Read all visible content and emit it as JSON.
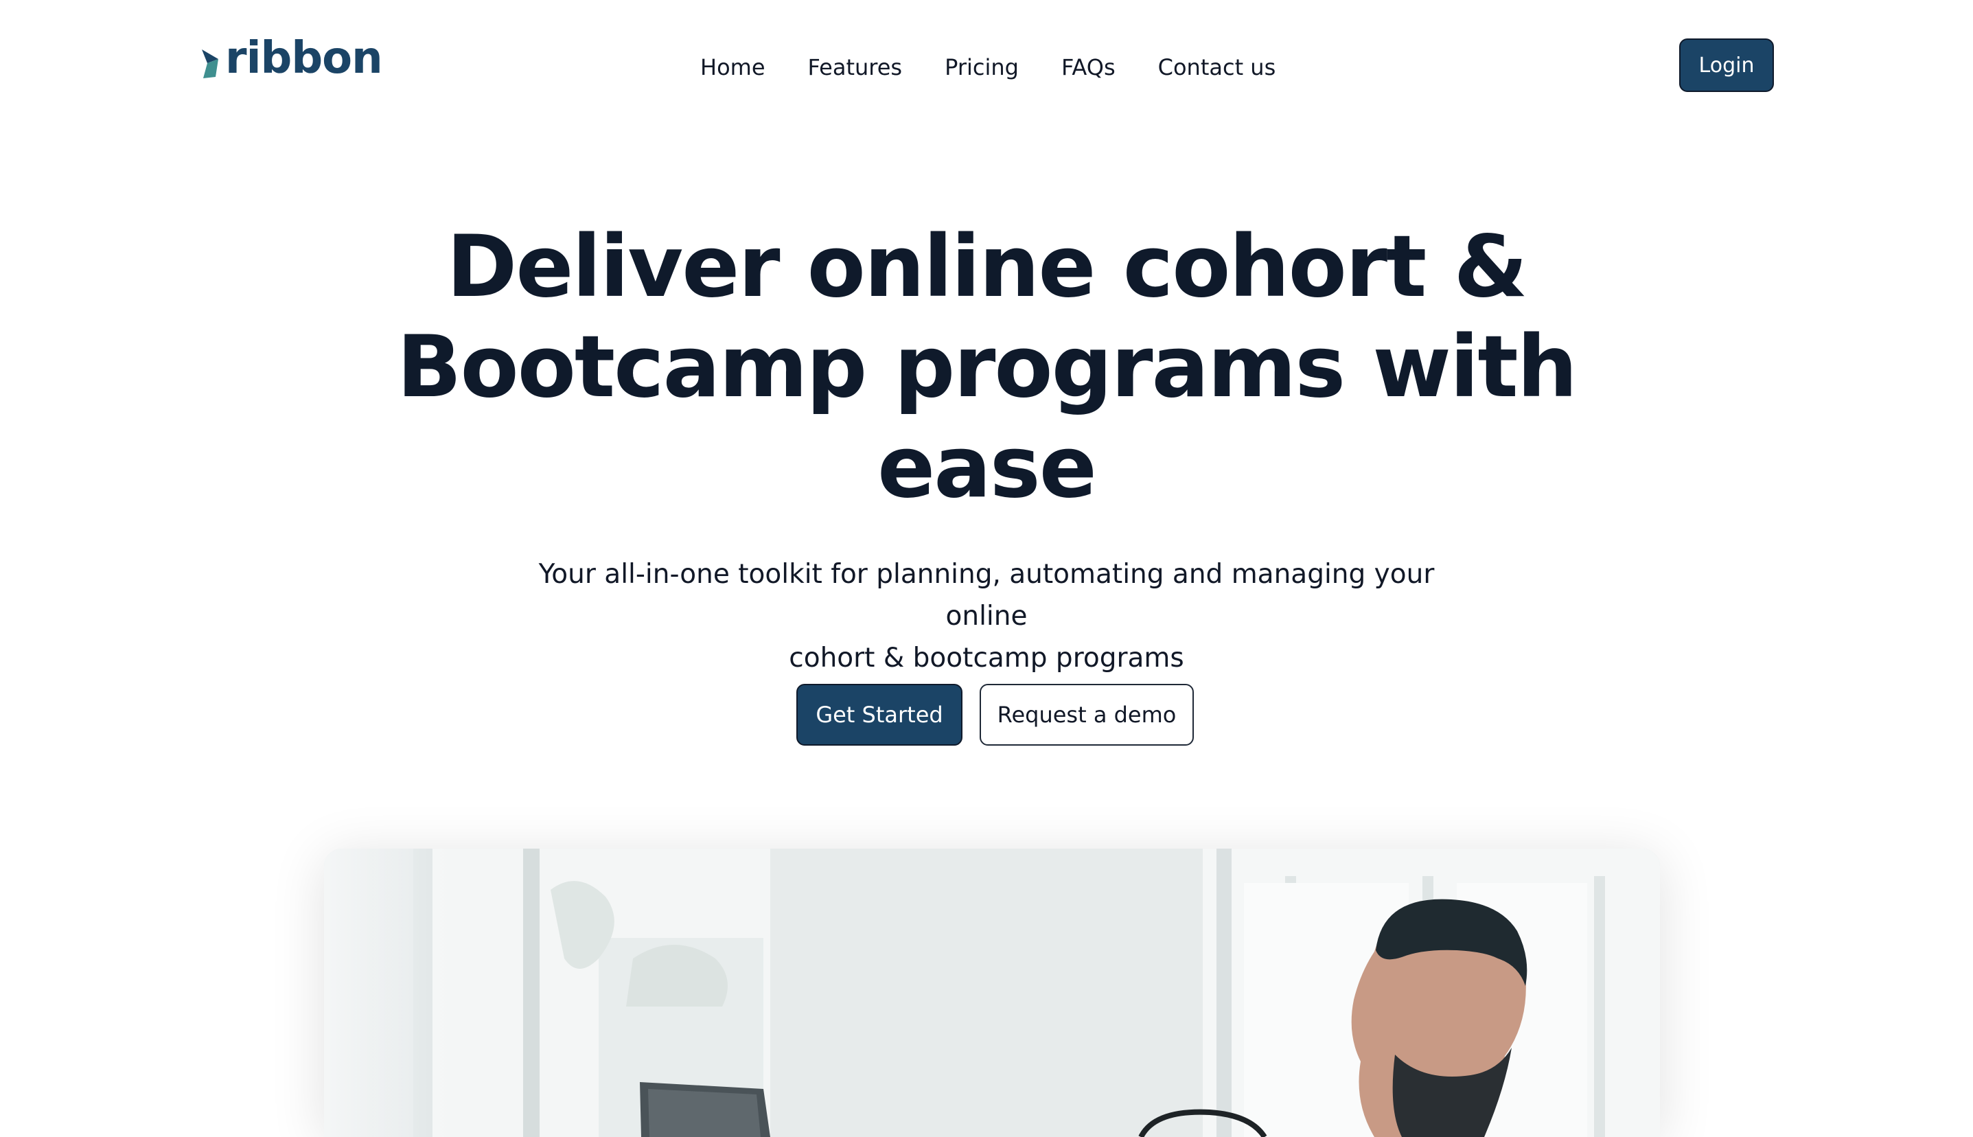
{
  "brand": {
    "name": "ribbon",
    "color": "#1b4466",
    "accent": "#3f8f8f"
  },
  "nav": {
    "items": [
      {
        "label": "Home"
      },
      {
        "label": "Features"
      },
      {
        "label": "Pricing"
      },
      {
        "label": "FAQs"
      },
      {
        "label": "Contact us"
      }
    ],
    "login_label": "Login"
  },
  "hero": {
    "title_lines": [
      "Deliver online cohort &",
      "Bootcamp programs with",
      "ease"
    ],
    "subtitle_lines": [
      "Your all-in-one toolkit for planning, automating and managing your online",
      "cohort & bootcamp programs"
    ],
    "primary_cta": "Get Started",
    "secondary_cta": "Request a demo"
  },
  "colors": {
    "primary": "#1b4466",
    "text": "#0f1a2b",
    "background": "#ffffff"
  }
}
